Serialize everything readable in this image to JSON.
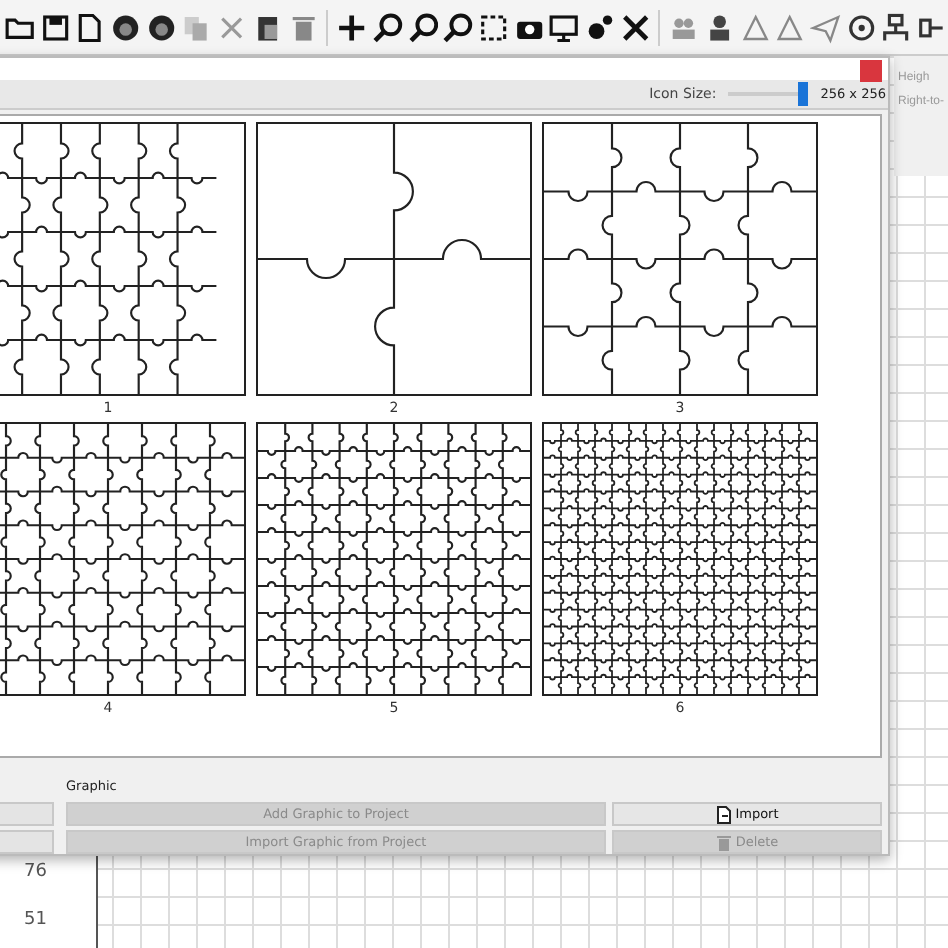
{
  "dialog": {
    "icon_size_label": "Icon Size:",
    "icon_size": {
      "level": 1.0
    },
    "icon_size_value": "256 x 256",
    "thumbnails": [
      {
        "label": "1"
      },
      {
        "label": "2"
      },
      {
        "label": "3"
      },
      {
        "label": "4"
      },
      {
        "label": "5"
      },
      {
        "label": "6"
      }
    ],
    "group_label": "Graphic",
    "buttons": [
      {
        "label": "Add Graphic to Project",
        "disabled": true,
        "kind": "wide"
      },
      {
        "label": "Import",
        "disabled": false,
        "kind": "import"
      },
      {
        "label": "Import Graphic from Project",
        "disabled": true,
        "kind": "wide"
      },
      {
        "label": "Delete",
        "disabled": true,
        "kind": "delete"
      }
    ]
  },
  "side_panel": {
    "texts": [
      "Heigh",
      "Right-to-"
    ]
  },
  "ruler": {
    "numbers": [
      "76",
      "51"
    ]
  }
}
